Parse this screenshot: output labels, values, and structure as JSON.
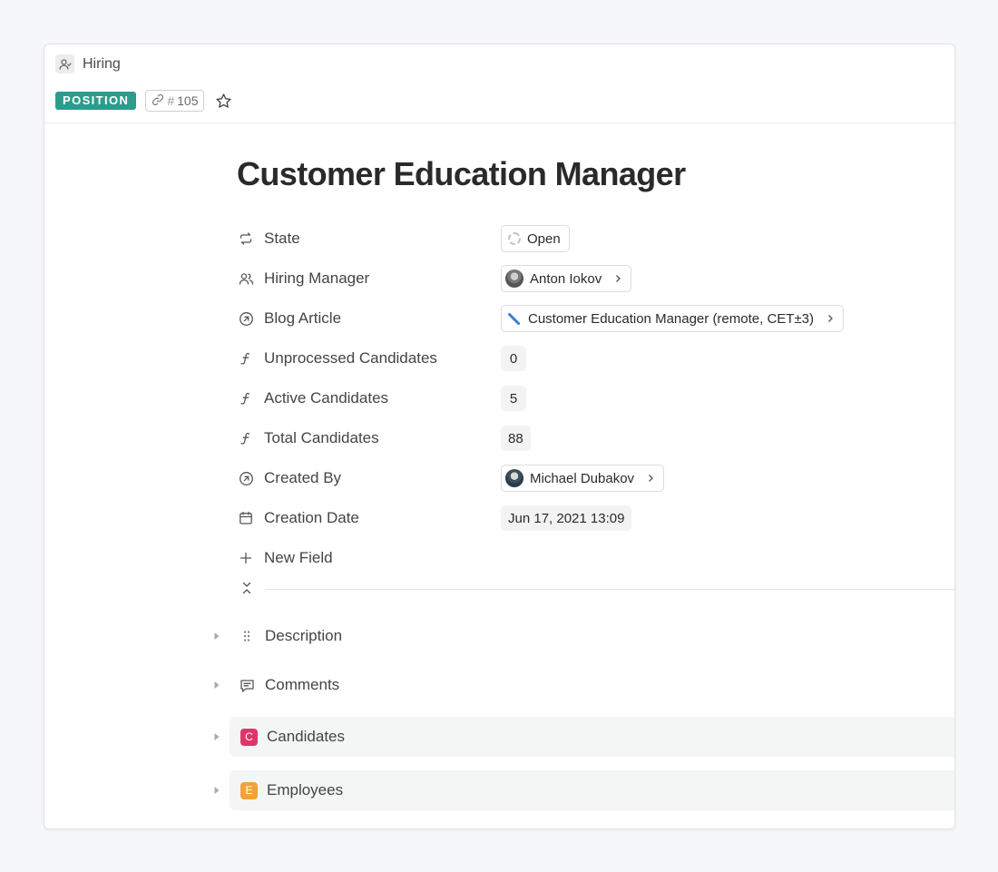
{
  "breadcrumb": {
    "label": "Hiring",
    "icon": "person-check-icon"
  },
  "header": {
    "type_badge": "POSITION",
    "type_badge_color": "#2c9c8c",
    "id_hash": "#",
    "id_number": "105"
  },
  "title": "Customer Education Manager",
  "fields": {
    "state": {
      "label": "State",
      "value": "Open"
    },
    "hiring_manager": {
      "label": "Hiring Manager",
      "value": "Anton Iokov"
    },
    "blog_article": {
      "label": "Blog Article",
      "value": "Customer Education Manager (remote, CET±3)"
    },
    "unprocessed": {
      "label": "Unprocessed Candidates",
      "value": "0"
    },
    "active": {
      "label": "Active Candidates",
      "value": "5"
    },
    "total": {
      "label": "Total Candidates",
      "value": "88"
    },
    "created_by": {
      "label": "Created By",
      "value": "Michael Dubakov"
    },
    "creation_date": {
      "label": "Creation Date",
      "value": "Jun 17, 2021 13:09"
    },
    "new_field": {
      "label": "New Field"
    }
  },
  "sections": {
    "description": {
      "label": "Description"
    },
    "comments": {
      "label": "Comments"
    },
    "candidates": {
      "label": "Candidates",
      "badge": "C",
      "badge_color": "#e0356b"
    },
    "employees": {
      "label": "Employees",
      "badge": "E",
      "badge_color": "#f0a23b"
    }
  }
}
